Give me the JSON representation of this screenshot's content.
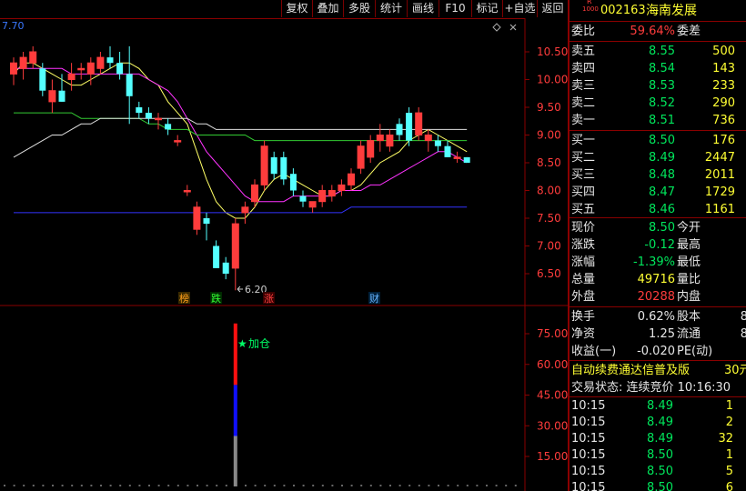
{
  "toolbar": {
    "items": [
      {
        "label": "复权"
      },
      {
        "label": "叠加"
      },
      {
        "label": "多股"
      },
      {
        "label": "统计"
      },
      {
        "label": "画线"
      },
      {
        "label": "F10"
      },
      {
        "label": "标记"
      },
      {
        "label": "+自选"
      },
      {
        "label": "返回"
      }
    ]
  },
  "stock": {
    "badge_top": "R",
    "badge_bottom": "1000",
    "code": "002163",
    "name": "海南发展"
  },
  "chart_data": [
    {
      "type": "candlestick",
      "title": "",
      "top_left_label": "7.70",
      "y_ticks": [
        "10.50",
        "10.00",
        "9.50",
        "9.00",
        "8.50",
        "8.00",
        "7.50",
        "7.00",
        "6.50"
      ],
      "ylim": [
        6.2,
        10.7
      ],
      "low_marker": "6.20",
      "event_markers": [
        "榜",
        "跌",
        "涨",
        "财"
      ],
      "candles": [
        {
          "o": 10.1,
          "h": 10.4,
          "l": 9.9,
          "c": 10.3
        },
        {
          "o": 10.2,
          "h": 10.5,
          "l": 10.0,
          "c": 10.4
        },
        {
          "o": 10.3,
          "h": 10.6,
          "l": 10.2,
          "c": 10.5
        },
        {
          "o": 10.2,
          "h": 10.3,
          "l": 9.7,
          "c": 9.8
        },
        {
          "o": 9.6,
          "h": 10.0,
          "l": 9.4,
          "c": 9.8
        },
        {
          "o": 9.8,
          "h": 10.1,
          "l": 9.6,
          "c": 9.6
        },
        {
          "o": 10.0,
          "h": 10.3,
          "l": 9.8,
          "c": 10.1
        },
        {
          "o": 10.2,
          "h": 10.3,
          "l": 10.0,
          "c": 10.2
        },
        {
          "o": 10.1,
          "h": 10.4,
          "l": 9.9,
          "c": 10.3
        },
        {
          "o": 10.2,
          "h": 10.5,
          "l": 10.1,
          "c": 10.4
        },
        {
          "o": 10.4,
          "h": 10.6,
          "l": 10.2,
          "c": 10.3
        },
        {
          "o": 10.3,
          "h": 10.5,
          "l": 10.0,
          "c": 10.1
        },
        {
          "o": 10.1,
          "h": 10.6,
          "l": 9.2,
          "c": 9.7
        },
        {
          "o": 9.5,
          "h": 9.6,
          "l": 9.3,
          "c": 9.4
        },
        {
          "o": 9.4,
          "h": 9.5,
          "l": 9.2,
          "c": 9.3
        },
        {
          "o": 9.3,
          "h": 9.4,
          "l": 9.1,
          "c": 9.3
        },
        {
          "o": 9.2,
          "h": 9.3,
          "l": 9.0,
          "c": 9.1
        },
        {
          "o": 8.9,
          "h": 9.0,
          "l": 8.8,
          "c": 8.9
        },
        {
          "o": 8.0,
          "h": 8.1,
          "l": 7.9,
          "c": 8.0
        },
        {
          "o": 7.3,
          "h": 7.8,
          "l": 7.2,
          "c": 7.7
        },
        {
          "o": 7.5,
          "h": 7.6,
          "l": 7.1,
          "c": 7.4
        },
        {
          "o": 7.0,
          "h": 7.1,
          "l": 6.6,
          "c": 6.6
        },
        {
          "o": 6.7,
          "h": 6.8,
          "l": 6.4,
          "c": 6.5
        },
        {
          "o": 6.6,
          "h": 7.5,
          "l": 6.2,
          "c": 7.4
        },
        {
          "o": 7.6,
          "h": 7.8,
          "l": 7.4,
          "c": 7.7
        },
        {
          "o": 7.8,
          "h": 8.2,
          "l": 7.7,
          "c": 8.1
        },
        {
          "o": 8.1,
          "h": 8.9,
          "l": 8.0,
          "c": 8.8
        },
        {
          "o": 8.6,
          "h": 8.7,
          "l": 8.2,
          "c": 8.3
        },
        {
          "o": 8.6,
          "h": 8.7,
          "l": 8.1,
          "c": 8.2
        },
        {
          "o": 8.3,
          "h": 8.4,
          "l": 7.9,
          "c": 8.0
        },
        {
          "o": 7.9,
          "h": 8.0,
          "l": 7.7,
          "c": 7.8
        },
        {
          "o": 7.7,
          "h": 7.8,
          "l": 7.6,
          "c": 7.8
        },
        {
          "o": 7.8,
          "h": 8.1,
          "l": 7.7,
          "c": 8.0
        },
        {
          "o": 7.9,
          "h": 8.1,
          "l": 7.8,
          "c": 8.0
        },
        {
          "o": 8.0,
          "h": 8.2,
          "l": 7.9,
          "c": 8.1
        },
        {
          "o": 8.1,
          "h": 8.4,
          "l": 8.0,
          "c": 8.3
        },
        {
          "o": 8.4,
          "h": 8.9,
          "l": 8.3,
          "c": 8.8
        },
        {
          "o": 8.6,
          "h": 9.0,
          "l": 8.5,
          "c": 8.9
        },
        {
          "o": 8.9,
          "h": 9.2,
          "l": 8.7,
          "c": 9.0
        },
        {
          "o": 8.8,
          "h": 9.1,
          "l": 8.7,
          "c": 9.0
        },
        {
          "o": 9.2,
          "h": 9.3,
          "l": 8.9,
          "c": 9.0
        },
        {
          "o": 9.4,
          "h": 9.5,
          "l": 8.8,
          "c": 8.9
        },
        {
          "o": 9.0,
          "h": 9.5,
          "l": 8.9,
          "c": 9.4
        },
        {
          "o": 8.9,
          "h": 9.1,
          "l": 8.7,
          "c": 9.0
        },
        {
          "o": 8.9,
          "h": 9.0,
          "l": 8.7,
          "c": 8.8
        },
        {
          "o": 8.8,
          "h": 8.9,
          "l": 8.6,
          "c": 8.6
        },
        {
          "o": 8.6,
          "h": 8.7,
          "l": 8.5,
          "c": 8.6
        },
        {
          "o": 8.6,
          "h": 8.6,
          "l": 8.5,
          "c": 8.5
        }
      ],
      "ma_lines": [
        {
          "color": "#ffff66",
          "values": [
            10.1,
            10.3,
            10.3,
            10.2,
            10.1,
            10.0,
            9.9,
            9.9,
            10.0,
            10.1,
            10.2,
            10.3,
            10.3,
            10.2,
            10.0,
            9.9,
            9.6,
            9.4,
            9.2,
            8.7,
            8.2,
            7.8,
            7.6,
            7.5,
            7.5,
            7.7,
            8.0,
            8.2,
            8.3,
            8.2,
            8.1,
            8.0,
            7.9,
            7.9,
            8.0,
            8.0,
            8.1,
            8.3,
            8.5,
            8.6,
            8.7,
            8.9,
            9.0,
            9.1,
            9.0,
            8.9,
            8.8,
            8.7
          ]
        },
        {
          "color": "#ff33ff",
          "values": [
            10.2,
            10.2,
            10.2,
            10.2,
            10.2,
            10.2,
            10.1,
            10.1,
            10.1,
            10.1,
            10.1,
            10.1,
            10.1,
            10.1,
            10.0,
            9.9,
            9.8,
            9.6,
            9.3,
            9.0,
            8.7,
            8.5,
            8.3,
            8.1,
            7.9,
            7.8,
            7.8,
            7.8,
            7.8,
            7.9,
            7.9,
            7.9,
            7.9,
            7.9,
            8.0,
            8.0,
            8.0,
            8.1,
            8.1,
            8.2,
            8.3,
            8.4,
            8.5,
            8.6,
            8.7,
            8.7,
            8.6,
            8.5
          ]
        },
        {
          "color": "#33cc33",
          "values": [
            9.4,
            9.4,
            9.4,
            9.4,
            9.4,
            9.4,
            9.4,
            9.3,
            9.3,
            9.3,
            9.3,
            9.3,
            9.3,
            9.3,
            9.2,
            9.2,
            9.1,
            9.1,
            9.1,
            9.0,
            9.0,
            9.0,
            9.0,
            9.0,
            9.0,
            8.9,
            8.9,
            8.9,
            8.9,
            8.9,
            8.9,
            8.9,
            8.9,
            8.9,
            8.9,
            8.9,
            8.9,
            8.9,
            8.9,
            8.9,
            8.9,
            8.9,
            8.9,
            8.9,
            8.9,
            8.9,
            8.9,
            8.9
          ]
        },
        {
          "color": "#e0e0e0",
          "values": [
            8.6,
            8.7,
            8.8,
            8.9,
            9.0,
            9.0,
            9.1,
            9.2,
            9.2,
            9.3,
            9.3,
            9.3,
            9.3,
            9.3,
            9.3,
            9.3,
            9.3,
            9.3,
            9.3,
            9.2,
            9.2,
            9.1,
            9.1,
            9.1,
            9.1,
            9.1,
            9.1,
            9.1,
            9.1,
            9.1,
            9.1,
            9.1,
            9.1,
            9.1,
            9.1,
            9.1,
            9.1,
            9.1,
            9.1,
            9.1,
            9.1,
            9.1,
            9.1,
            9.1,
            9.1,
            9.1,
            9.1,
            9.1
          ]
        },
        {
          "color": "#3333ff",
          "values": [
            7.6,
            7.6,
            7.6,
            7.6,
            7.6,
            7.6,
            7.6,
            7.6,
            7.6,
            7.6,
            7.6,
            7.6,
            7.6,
            7.6,
            7.6,
            7.6,
            7.6,
            7.6,
            7.6,
            7.6,
            7.6,
            7.6,
            7.6,
            7.6,
            7.6,
            7.6,
            7.6,
            7.6,
            7.6,
            7.6,
            7.6,
            7.6,
            7.6,
            7.6,
            7.6,
            7.7,
            7.7,
            7.7,
            7.7,
            7.7,
            7.7,
            7.7,
            7.7,
            7.7,
            7.7,
            7.7,
            7.7,
            7.7
          ]
        }
      ]
    },
    {
      "type": "bar",
      "title": "",
      "y_ticks": [
        "75.00",
        "60.00",
        "45.00",
        "30.00",
        "15.00"
      ],
      "ylim": [
        0,
        80
      ],
      "signal_label": "加仓",
      "signal_bar_segments": [
        {
          "from": 0,
          "to": 25,
          "color": "#888888"
        },
        {
          "from": 25,
          "to": 50,
          "color": "#1010ff"
        },
        {
          "from": 50,
          "to": 80,
          "color": "#ff1010"
        }
      ]
    }
  ],
  "quote": {
    "weibi": {
      "label": "委比",
      "value": "59.64%",
      "label2": "委差"
    },
    "sell": [
      {
        "label": "卖五",
        "price": "8.55",
        "vol": "500"
      },
      {
        "label": "卖四",
        "price": "8.54",
        "vol": "143"
      },
      {
        "label": "卖三",
        "price": "8.53",
        "vol": "233"
      },
      {
        "label": "卖二",
        "price": "8.52",
        "vol": "290"
      },
      {
        "label": "卖一",
        "price": "8.51",
        "vol": "736"
      }
    ],
    "buy": [
      {
        "label": "买一",
        "price": "8.50",
        "vol": "176"
      },
      {
        "label": "买二",
        "price": "8.49",
        "vol": "2447"
      },
      {
        "label": "买三",
        "price": "8.48",
        "vol": "2011"
      },
      {
        "label": "买四",
        "price": "8.47",
        "vol": "1729"
      },
      {
        "label": "买五",
        "price": "8.46",
        "vol": "1161"
      }
    ],
    "stats": [
      {
        "l1": "现价",
        "v1": "8.50",
        "l2": "今开"
      },
      {
        "l1": "涨跌",
        "v1": "-0.12",
        "l2": "最高"
      },
      {
        "l1": "涨幅",
        "v1": "-1.39%",
        "l2": "最低"
      },
      {
        "l1": "总量",
        "v1": "49716",
        "l2": "量比"
      },
      {
        "l1": "外盘",
        "v1": "20288",
        "l2": "内盘"
      }
    ],
    "stats2": [
      {
        "l1": "换手",
        "v1": "0.62%",
        "l2": "股本",
        "v2": "8"
      },
      {
        "l1": "净资",
        "v1": "1.25",
        "l2": "流通",
        "v2": "8"
      },
      {
        "l1": "收益(一)",
        "v1": "-0.020",
        "l2": "PE(动)",
        "v2": ""
      }
    ],
    "promo": {
      "text": "自动续费通达信普及版",
      "price": "30元"
    },
    "trade_status": "交易状态: 连续竞价 10:16:30",
    "ticks": [
      {
        "time": "10:15",
        "price": "8.49",
        "vol": "1"
      },
      {
        "time": "10:15",
        "price": "8.49",
        "vol": "2"
      },
      {
        "time": "10:15",
        "price": "8.49",
        "vol": "32"
      },
      {
        "time": "10:15",
        "price": "8.50",
        "vol": "1"
      },
      {
        "time": "10:15",
        "price": "8.50",
        "vol": "5"
      },
      {
        "time": "10:15",
        "price": "8.50",
        "vol": "6"
      }
    ]
  }
}
